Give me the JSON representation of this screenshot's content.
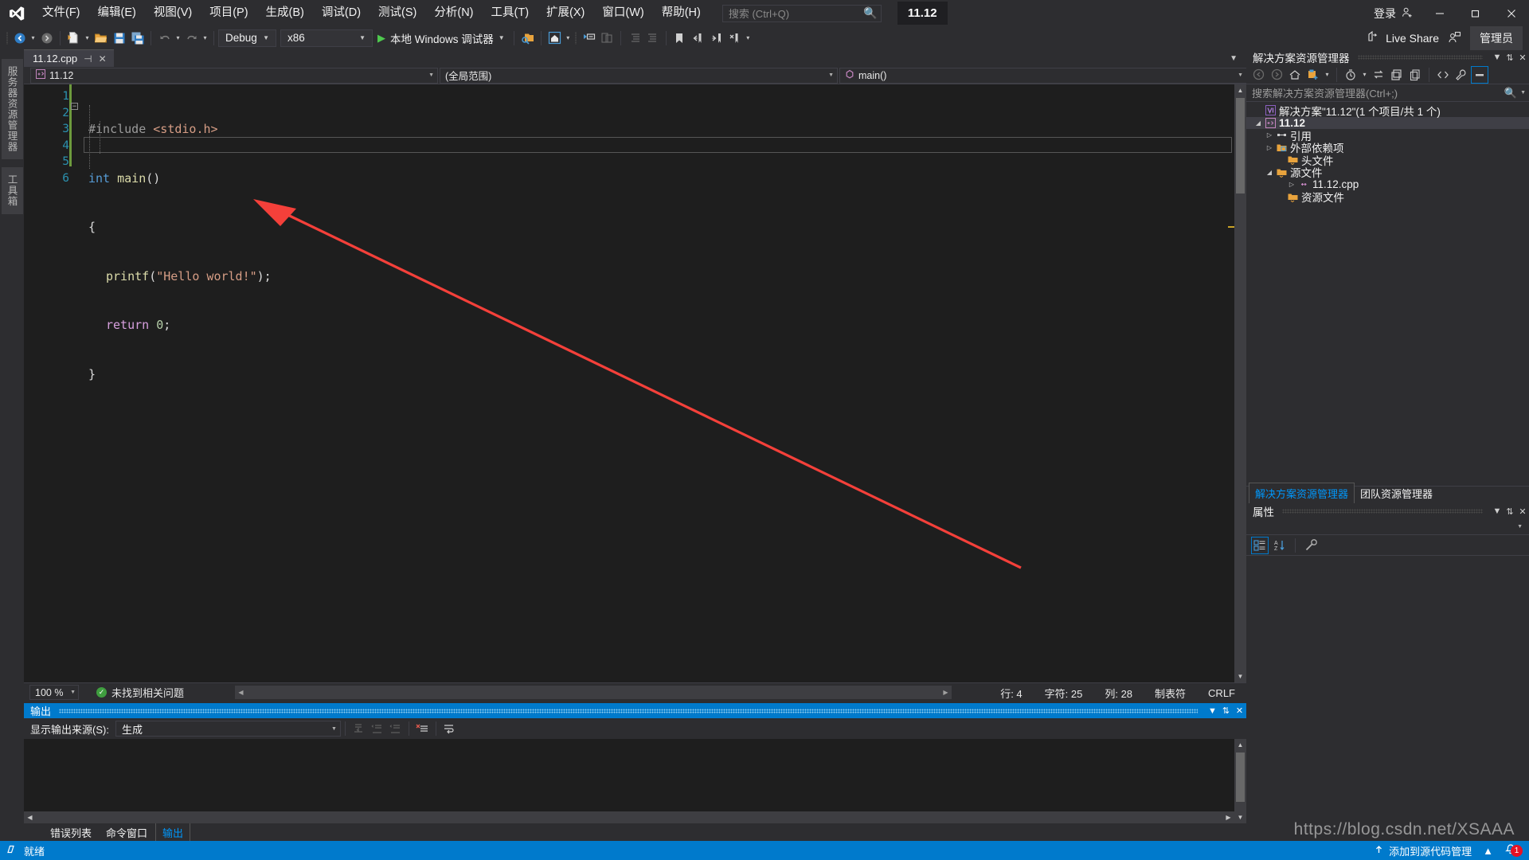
{
  "menubar": {
    "logo_icon": "visual-studio-logo",
    "items": [
      {
        "label": "文件(F)"
      },
      {
        "label": "编辑(E)"
      },
      {
        "label": "视图(V)"
      },
      {
        "label": "项目(P)"
      },
      {
        "label": "生成(B)"
      },
      {
        "label": "调试(D)"
      },
      {
        "label": "测试(S)"
      },
      {
        "label": "分析(N)"
      },
      {
        "label": "工具(T)"
      },
      {
        "label": "扩展(X)"
      },
      {
        "label": "窗口(W)"
      },
      {
        "label": "帮助(H)"
      }
    ],
    "search_placeholder": "搜索 (Ctrl+Q)",
    "search_icon": "search-icon",
    "solution_chip": "11.12",
    "signin_label": "登录",
    "signin_icon": "account-add-icon",
    "minimize_icon": "minimize-icon",
    "maximize_icon": "maximize-icon",
    "close_icon": "close-icon"
  },
  "toolbar": {
    "nav_back_icon": "navigate-back-icon",
    "nav_forward_icon": "navigate-forward-icon",
    "new_item_icon": "new-file-icon",
    "open_icon": "open-folder-icon",
    "save_icon": "save-icon",
    "save_all_icon": "save-all-icon",
    "undo_icon": "undo-icon",
    "redo_icon": "redo-icon",
    "config_value": "Debug",
    "platform_value": "x86",
    "run_label": "本地 Windows 调试器",
    "run_icon": "play-icon",
    "attach_icon": "attach-process-icon",
    "find_icon": "find-in-files-icon",
    "home_icon": "home-icon",
    "step_icon": "step-icon",
    "comment_icon": "comment-icon",
    "uncomment_icon": "uncomment-icon",
    "indent_icon": "indent-icon",
    "outdent_icon": "outdent-icon",
    "bookmark_icon": "bookmark-icon",
    "prev_bookmark_icon": "previous-bookmark-icon",
    "next_bookmark_icon": "next-bookmark-icon",
    "clear_bookmark_icon": "clear-bookmark-icon",
    "overflow_icon": "toolbar-overflow-icon",
    "live_share_label": "Live Share",
    "live_share_icon": "live-share-icon",
    "feedback_icon": "feedback-icon",
    "admin_label": "管理员"
  },
  "left_rail": {
    "tabs": [
      {
        "label": "服务器资源管理器"
      },
      {
        "label": "工具箱"
      }
    ]
  },
  "editor": {
    "tab": {
      "title": "11.12.cpp",
      "pin_icon": "pin-icon",
      "close_icon": "close-icon"
    },
    "navbar": {
      "project_value": "11.12",
      "project_icon": "cpp-project-icon",
      "scope_value": "(全局范围)",
      "member_value": "main()",
      "member_icon": "method-icon"
    },
    "line_numbers": [
      "1",
      "2",
      "3",
      "4",
      "5",
      "6"
    ],
    "code": {
      "line1": {
        "pre": "#include",
        "sp": " ",
        "str": "<stdio.h>"
      },
      "line2": {
        "kw": "int",
        "sp": " ",
        "fn": "main",
        "punc": "()"
      },
      "line3": {
        "punc": "{"
      },
      "line4": {
        "fn": "printf",
        "p1": "(",
        "str": "\"Hello world!\"",
        "p2": ");"
      },
      "line5": {
        "kw": "return",
        "sp": " ",
        "num": "0",
        "punc": ";"
      },
      "line6": {
        "punc": "}"
      }
    },
    "status": {
      "zoom": "100 %",
      "issues_label": "未找到相关问题",
      "issues_icon": "check-circle-icon",
      "line_label": "行: 4",
      "char_label": "字符: 25",
      "col_label": "列: 28",
      "tab_label": "制表符",
      "eol_label": "CRLF"
    }
  },
  "output": {
    "title": "输出",
    "dropdown_icon": "chevron-down-icon",
    "pin_icon": "pin-icon",
    "close_icon": "close-icon",
    "source_label": "显示输出来源(S):",
    "source_value": "生成",
    "body_text": "",
    "toolbar_icons": [
      "go-to-message-icon",
      "previous-message-icon",
      "next-message-icon",
      "clear-all-icon",
      "toggle-word-wrap-icon"
    ],
    "tabs": [
      {
        "label": "错误列表",
        "active": false
      },
      {
        "label": "命令窗口",
        "active": false
      },
      {
        "label": "输出",
        "active": true
      }
    ]
  },
  "solution_explorer": {
    "title": "解决方案资源管理器",
    "dropdown_icon": "chevron-down-icon",
    "pin_icon": "pin-icon",
    "close_icon": "close-icon",
    "toolbar_icons": [
      "back-icon",
      "forward-icon",
      "home-icon",
      "add-new-item-icon",
      "pending-changes-icon",
      "sync-icon",
      "collapse-all-icon",
      "refresh-icon",
      "show-all-files-icon",
      "properties-icon",
      "preview-selected-icon"
    ],
    "search_placeholder": "搜索解决方案资源管理器(Ctrl+;)",
    "search_icon": "search-icon",
    "tree": [
      {
        "indent": 0,
        "twisty": "",
        "icon": "solution-icon",
        "label": "解决方案\"11.12\"(1 个项目/共 1 个)",
        "selected": false
      },
      {
        "indent": 1,
        "twisty": "expanded",
        "icon": "cpp-project-icon",
        "label": "11.12",
        "selected": true
      },
      {
        "indent": 2,
        "twisty": "collapsed",
        "icon": "references-icon",
        "label": "引用",
        "selected": false
      },
      {
        "indent": 2,
        "twisty": "collapsed",
        "icon": "external-deps-icon",
        "label": "外部依赖项",
        "selected": false
      },
      {
        "indent": 2,
        "twisty": "",
        "icon": "folder-filter-icon",
        "label": "头文件",
        "selected": false
      },
      {
        "indent": 2,
        "twisty": "expanded",
        "icon": "folder-filter-icon",
        "label": "源文件",
        "selected": false
      },
      {
        "indent": 3,
        "twisty": "collapsed",
        "icon": "cpp-file-icon",
        "label": "11.12.cpp",
        "selected": false
      },
      {
        "indent": 2,
        "twisty": "",
        "icon": "folder-filter-icon",
        "label": "资源文件",
        "selected": false
      }
    ],
    "tabs": [
      {
        "label": "解决方案资源管理器",
        "active": true
      },
      {
        "label": "团队资源管理器",
        "active": false
      }
    ]
  },
  "properties": {
    "title": "属性",
    "dropdown_icon": "chevron-down-icon",
    "pin_icon": "pin-icon",
    "close_icon": "close-icon",
    "object_value": "",
    "toolbar_icons": [
      "categorized-icon",
      "alphabetical-icon",
      "property-pages-icon"
    ]
  },
  "statusbar": {
    "ready_label": "就绪",
    "ready_icon": "ready-icon",
    "source_control_label": "添加到源代码管理",
    "source_control_icon": "upload-icon",
    "select_repo_icon": "chevron-up-icon",
    "notifications_icon": "bell-icon",
    "notifications_count": "1"
  },
  "watermark": "https://blog.csdn.net/XSAAA",
  "colors": {
    "accent": "#007acc",
    "chrome": "#2d2d30",
    "editor_bg": "#1e1e1e",
    "panel_bg": "#252526",
    "annotation_red": "#f4403a",
    "linenum": "#2b91af",
    "string": "#d69d85",
    "keyword": "#569cd6",
    "function": "#dcdcaa"
  }
}
